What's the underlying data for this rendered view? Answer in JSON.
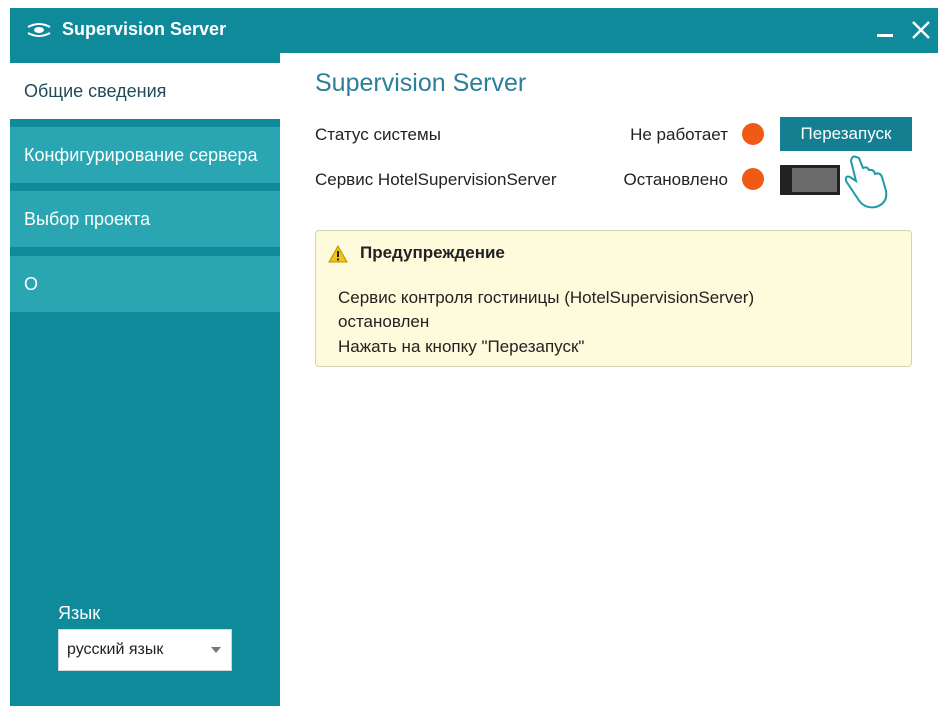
{
  "window": {
    "title": "Supervision Server",
    "minimize_icon": "minimize-icon",
    "close_icon": "close-icon"
  },
  "sidebar": {
    "items": [
      {
        "label": "Общие сведения",
        "active": true
      },
      {
        "label": "Конфигурирование сервера",
        "active": false
      },
      {
        "label": "Выбор проекта",
        "active": false
      },
      {
        "label": "О",
        "active": false
      }
    ],
    "language_label": "Язык",
    "language_value": "русский язык"
  },
  "main": {
    "title": "Supervision Server",
    "system_status": {
      "label": "Статус системы",
      "value": "Не работает",
      "indicator_color": "#f05a14"
    },
    "service_status": {
      "label": "Сервис HotelSupervisionServer",
      "value": "Остановлено",
      "indicator_color": "#f05a14"
    },
    "restart_button": "Перезапуск",
    "warning": {
      "title": "Предупреждение",
      "lines": [
        "Сервис контроля гостиницы (HotelSupervisionServer)",
        "остановлен",
        "Нажать на кнопку \"Перезапуск\""
      ]
    }
  },
  "colors": {
    "accent": "#0e8a9a",
    "nav_item": "#2aa6b3",
    "button": "#137f91",
    "title_text": "#2a7f9a",
    "warning_bg": "#fdfbdc"
  }
}
